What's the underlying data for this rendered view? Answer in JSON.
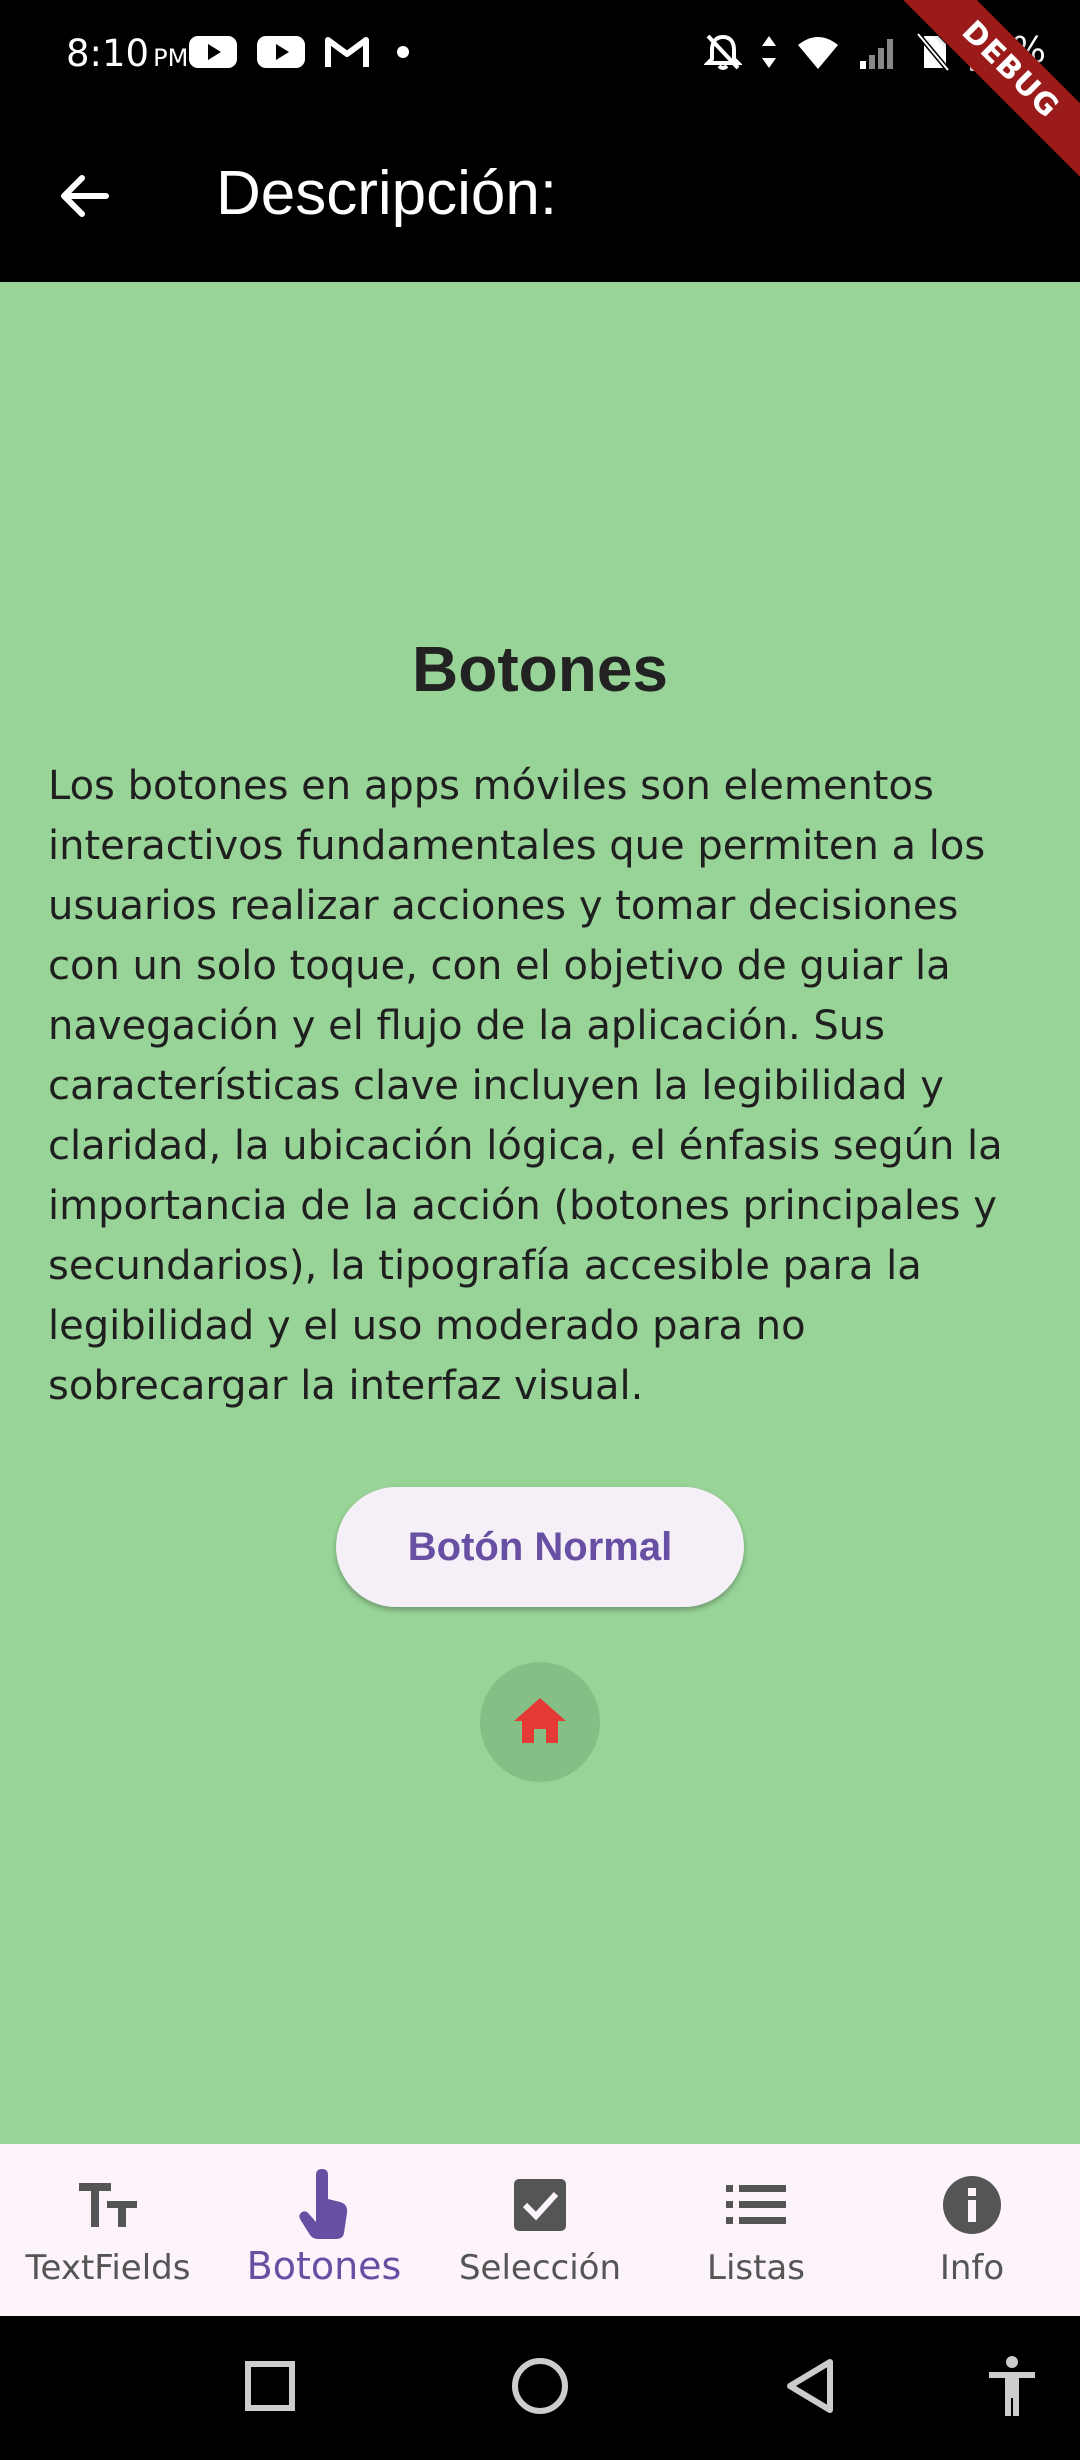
{
  "status_bar": {
    "time": "8:10",
    "ampm": "PM",
    "battery_text": "99%",
    "left_icons": [
      "youtube-icon",
      "youtube-icon",
      "gmail-icon",
      "dot-icon"
    ],
    "right_icons": [
      "bell-off-icon",
      "data-arrows-icon",
      "wifi-icon",
      "signal-icon",
      "no-sim-icon",
      "battery-icon"
    ]
  },
  "debug_banner": "DEBUG",
  "app_bar": {
    "title": "Descripción:",
    "back_icon": "arrow-back-icon"
  },
  "content": {
    "background": "#98d497",
    "title": "Botones",
    "description": "Los botones en apps móviles son elementos interactivos fundamentales que permiten a los usuarios realizar acciones y tomar decisiones con un solo toque, con el objetivo de guiar la navegación y el flujo de la aplicación. Sus características clave incluyen la legibilidad y claridad, la ubicación lógica, el énfasis según la importancia de la acción (botones principales y secundarios), la tipografía accesible para la legibilidad y el uso moderado para no sobrecargar la interfaz visual.",
    "normal_button_label": "Botón Normal",
    "icon_button_icon": "home-icon",
    "icon_button_color": "#e53935"
  },
  "bottom_nav": {
    "active_color": "#6750a4",
    "items": [
      {
        "label": "TextFields",
        "icon": "text-fields-icon",
        "active": false
      },
      {
        "label": "Botones",
        "icon": "touch-icon",
        "active": true
      },
      {
        "label": "Selección",
        "icon": "checkbox-icon",
        "active": false
      },
      {
        "label": "Listas",
        "icon": "list-icon",
        "active": false
      },
      {
        "label": "Info",
        "icon": "info-icon",
        "active": false
      }
    ]
  },
  "system_nav": [
    "recents-square-icon",
    "home-circle-icon",
    "back-triangle-icon",
    "accessibility-icon"
  ]
}
